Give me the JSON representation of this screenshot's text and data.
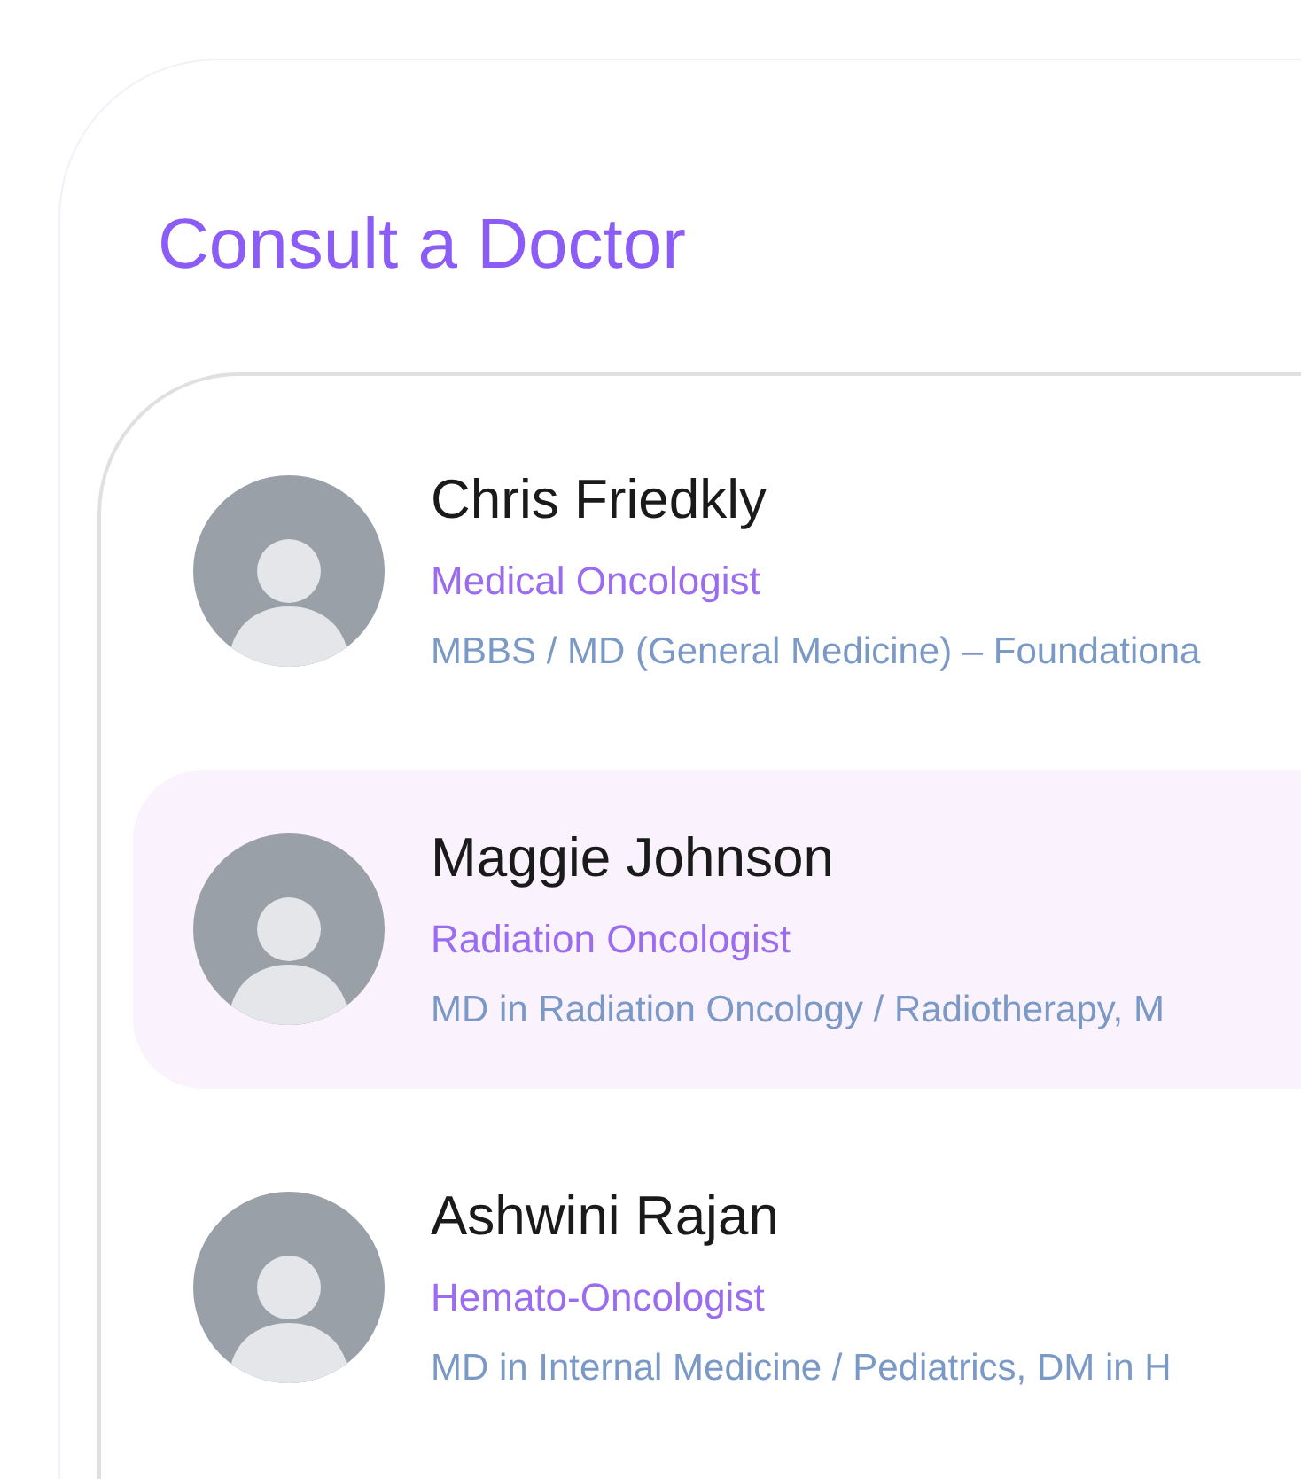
{
  "title": "Consult a Doctor",
  "doctors": [
    {
      "name": "Chris Friedkly",
      "specialty": "Medical Oncologist",
      "qualification": "MBBS / MD (General Medicine) – Foundationa",
      "selected": false
    },
    {
      "name": "Maggie Johnson",
      "specialty": "Radiation Oncologist",
      "qualification": "MD in Radiation Oncology / Radiotherapy,  M",
      "selected": true
    },
    {
      "name": "Ashwini Rajan",
      "specialty": "Hemato-Oncologist",
      "qualification": "MD in Internal Medicine / Pediatrics,  DM in H",
      "selected": false
    }
  ]
}
